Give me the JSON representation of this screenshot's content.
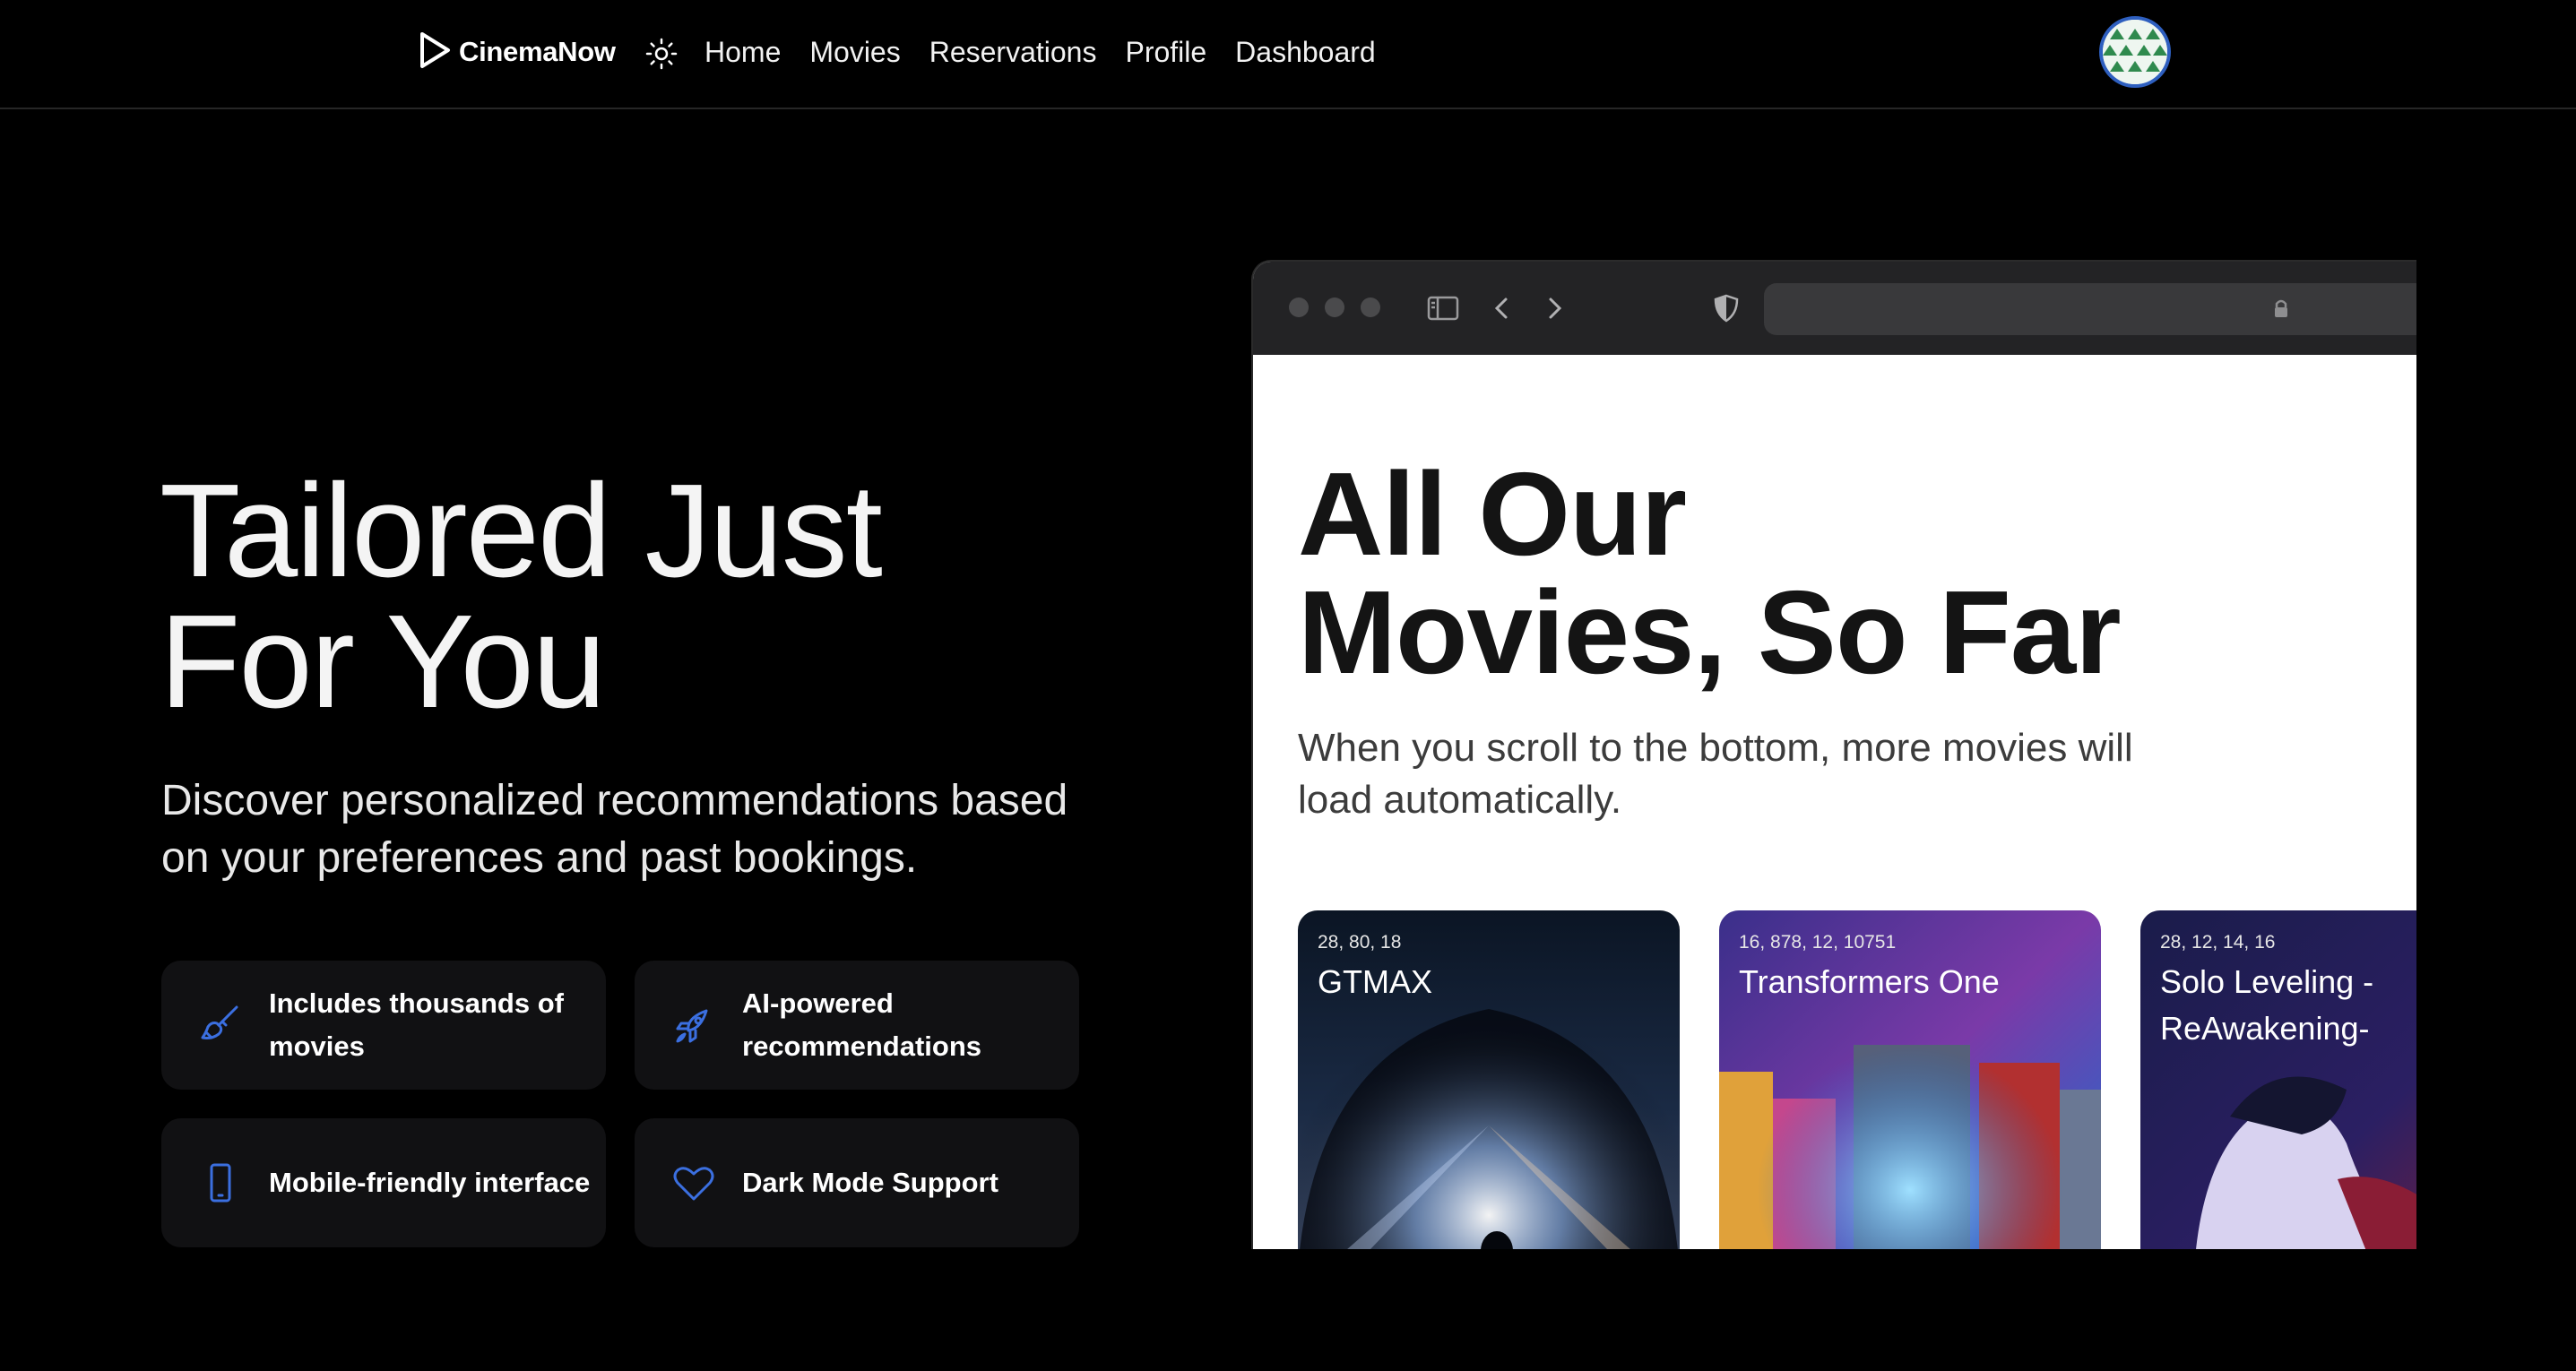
{
  "nav": {
    "brand": "CinemaNow",
    "links": [
      "Home",
      "Movies",
      "Reservations",
      "Profile",
      "Dashboard"
    ],
    "icons": {
      "logo": "play-icon",
      "theme": "sun-icon",
      "avatar": "user-avatar"
    }
  },
  "hero": {
    "title_line1": "Tailored Just",
    "title_line2": "For You",
    "subtitle": "Discover personalized recommendations based on your preferences and past bookings."
  },
  "features": [
    {
      "label": "Includes thousands of movies",
      "icon": "brush-icon"
    },
    {
      "label": "AI-powered recommendations",
      "icon": "rocket-icon"
    },
    {
      "label": "Mobile-friendly interface",
      "icon": "phone-icon"
    },
    {
      "label": "Dark Mode Support",
      "icon": "heart-icon"
    }
  ],
  "preview": {
    "title_line1": "All Our",
    "title_line2": "Movies, So Far",
    "subtitle": "When you scroll to the bottom, more movies will load automatically.",
    "movies": [
      {
        "ids": "28, 80, 18",
        "title": "GTMAX"
      },
      {
        "ids": "16, 878, 12, 10751",
        "title": "Transformers One"
      },
      {
        "ids": "28, 12, 14, 16",
        "title": "Solo Leveling - ReAwakening-"
      }
    ]
  },
  "colors": {
    "accent": "#3b6fe0",
    "background": "#000000",
    "card": "#111113"
  }
}
